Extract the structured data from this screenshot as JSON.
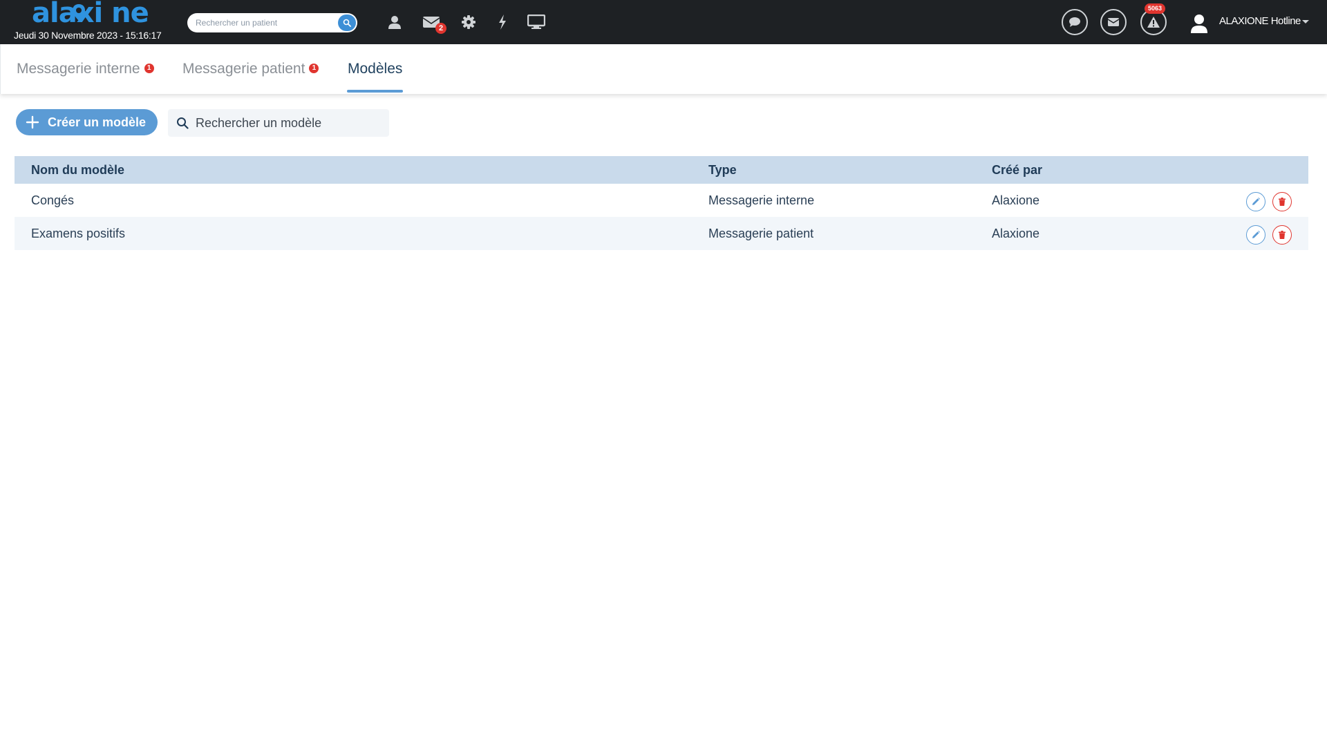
{
  "app": {
    "logo_text": "alaxi ne",
    "datetime": "Jeudi 30 Novembre 2023 - 15:16:17",
    "patient_search": {
      "placeholder": "Rechercher un patient"
    },
    "mail_badge": "2",
    "alert_badge": "5063",
    "user_name": "ALAXIONE Hotline",
    "colors": {
      "topbar": "#1e2124",
      "accent": "#5b9bd5",
      "badge": "#e0352f",
      "header_row": "#c9daeb"
    }
  },
  "tabs": [
    {
      "label": "Messagerie interne",
      "badge": "1",
      "active": false
    },
    {
      "label": "Messagerie patient",
      "badge": "1",
      "active": false
    },
    {
      "label": "Modèles",
      "badge": "",
      "active": true
    }
  ],
  "toolbar": {
    "create_label": "Créer un modèle",
    "search_placeholder": "Rechercher un modèle"
  },
  "table": {
    "columns": [
      "Nom du modèle",
      "Type",
      "Créé par"
    ],
    "rows": [
      {
        "name": "Congés",
        "type": "Messagerie interne",
        "author": "Alaxione"
      },
      {
        "name": "Examens positifs",
        "type": "Messagerie patient",
        "author": "Alaxione"
      }
    ]
  },
  "icons": {
    "user": "user-icon",
    "mail": "envelope-icon",
    "settings": "gear-icon",
    "flash": "lightning-icon",
    "screen": "monitor-icon",
    "chat": "chat-icon",
    "alert": "warning-icon",
    "edit": "pencil-icon",
    "delete": "trash-icon"
  }
}
